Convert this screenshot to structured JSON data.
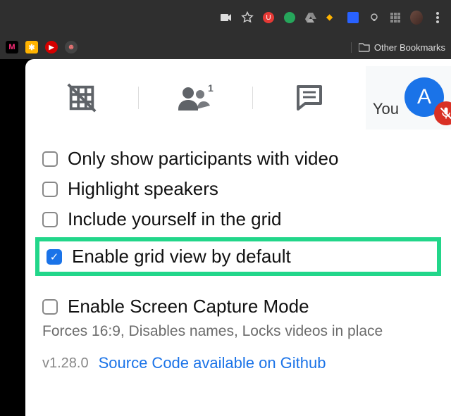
{
  "browser": {
    "bookmarks_label": "Other Bookmarks"
  },
  "tabs": {
    "you_label": "You",
    "avatar_initial": "A"
  },
  "options": [
    {
      "label": "Only show participants with video",
      "checked": false
    },
    {
      "label": "Highlight speakers",
      "checked": false
    },
    {
      "label": "Include yourself in the grid",
      "checked": false
    },
    {
      "label": "Enable grid view by default",
      "checked": true,
      "highlighted": true
    },
    {
      "label": "Enable Screen Capture Mode",
      "checked": false,
      "sub": "Forces 16:9, Disables names, Locks videos in place"
    }
  ],
  "footer": {
    "version": "v1.28.0",
    "link": "Source Code available on Github"
  }
}
